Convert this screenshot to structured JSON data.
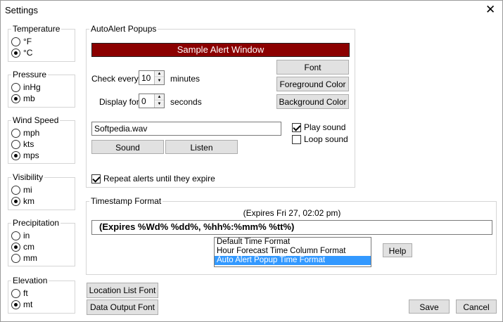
{
  "window": {
    "title": "Settings"
  },
  "units": {
    "temperature": {
      "label": "Temperature",
      "options": [
        "°F",
        "°C"
      ],
      "selected": 1
    },
    "pressure": {
      "label": "Pressure",
      "options": [
        "inHg",
        "mb"
      ],
      "selected": 1
    },
    "wind_speed": {
      "label": "Wind Speed",
      "options": [
        "mph",
        "kts",
        "mps"
      ],
      "selected": 2
    },
    "visibility": {
      "label": "Visibility",
      "options": [
        "mi",
        "km"
      ],
      "selected": 1
    },
    "precipitation": {
      "label": "Precipitation",
      "options": [
        "in",
        "cm",
        "mm"
      ],
      "selected": 1
    },
    "elevation": {
      "label": "Elevation",
      "options": [
        "ft",
        "mt"
      ],
      "selected": 1
    }
  },
  "autoalert": {
    "label": "AutoAlert Popups",
    "sample": "Sample Alert Window",
    "sample_bg": "#8b0000",
    "check_every_label": "Check every",
    "check_every_value": "10",
    "check_every_unit": "minutes",
    "display_for_label": "Display for",
    "display_for_value": "0",
    "display_for_unit": "seconds",
    "font_button": "Font",
    "fg_button": "Foreground Color",
    "bg_button": "Background Color",
    "sound_file": "Softpedia.wav",
    "sound_button": "Sound",
    "listen_button": "Listen",
    "play_sound": "Play sound",
    "play_sound_checked": true,
    "loop_sound": "Loop sound",
    "loop_sound_checked": false,
    "repeat_alerts": "Repeat alerts until they expire",
    "repeat_checked": true
  },
  "timestamp": {
    "label": "Timestamp Format",
    "preview": "(Expires Fri 27, 02:02 pm)",
    "format": "(Expires %Wd% %dd%, %hh%:%mm% %tt%)",
    "list": [
      "Default Time Format",
      "Hour Forecast Time Column Format",
      "Auto Alert Popup Time Format"
    ],
    "selected": 2,
    "help_button": "Help"
  },
  "bottom": {
    "location_font": "Location List Font",
    "data_font": "Data Output Font",
    "save": "Save",
    "cancel": "Cancel"
  }
}
